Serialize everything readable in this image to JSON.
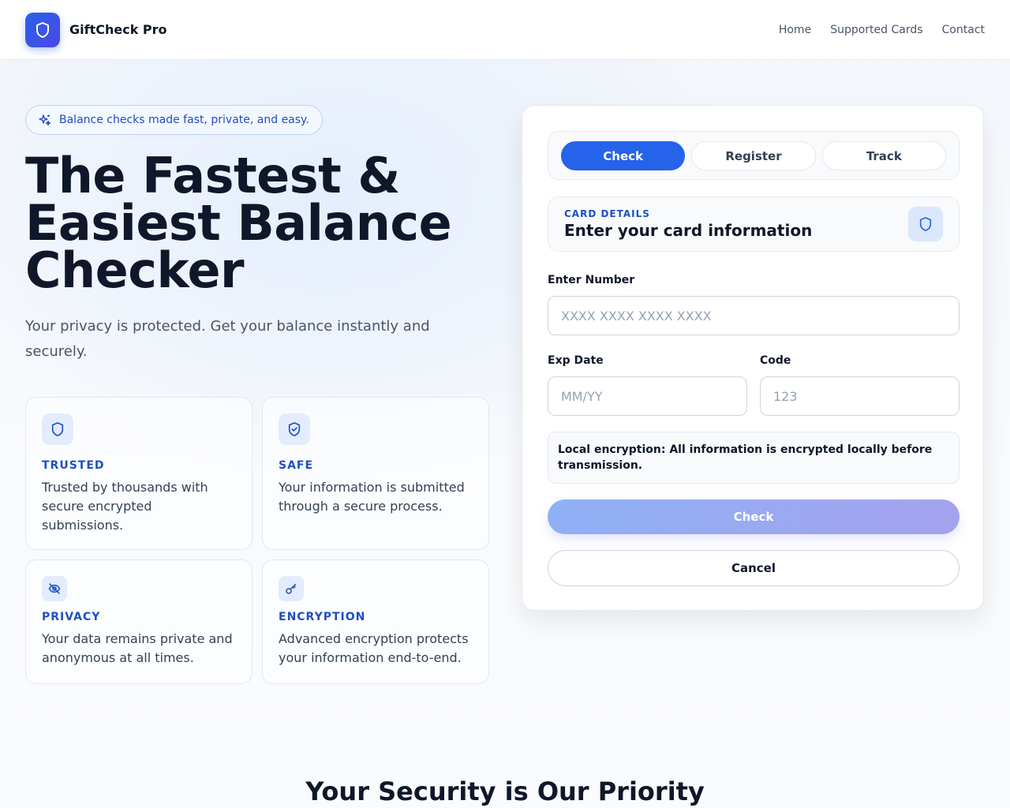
{
  "header": {
    "brand": "GiftCheck Pro",
    "nav": [
      "Home",
      "Supported Cards",
      "Contact"
    ]
  },
  "hero": {
    "pill": "Balance checks made fast, private, and easy.",
    "title_lines": [
      "The Fastest &",
      "Easiest Balance",
      "Checker"
    ],
    "subtitle": "Your privacy is protected. Get your balance instantly and securely."
  },
  "features": [
    {
      "icon": "shield-icon",
      "title": "TRUSTED",
      "desc": "Trusted by thousands with secure encrypted submissions."
    },
    {
      "icon": "shield-check-icon",
      "title": "SAFE",
      "desc": "Your information is submitted through a secure process."
    },
    {
      "icon": "eye-off-icon",
      "title": "PRIVACY",
      "desc": "Your data remains private and anonymous at all times."
    },
    {
      "icon": "key-icon",
      "title": "ENCRYPTION",
      "desc": "Advanced encryption protects your information end-to-end."
    }
  ],
  "panel": {
    "tabs": [
      "Check",
      "Register",
      "Track"
    ],
    "active_tab": "Check",
    "details_kicker": "CARD DETAILS",
    "details_title": "Enter your card information",
    "number_label": "Enter Number",
    "number_placeholder": "XXXX XXXX XXXX XXXX",
    "exp_label": "Exp Date",
    "exp_placeholder": "MM/YY",
    "code_label": "Code",
    "code_placeholder": "123",
    "notice": "Local encryption: All information is encrypted locally before transmission.",
    "check_button": "Check",
    "cancel_button": "Cancel"
  },
  "section": {
    "title": "Your Security is Our Priority"
  },
  "colors": {
    "primary": "#2563eb",
    "accent_text": "#1e4fc0",
    "heading": "#0f172a",
    "muted": "#475569"
  }
}
